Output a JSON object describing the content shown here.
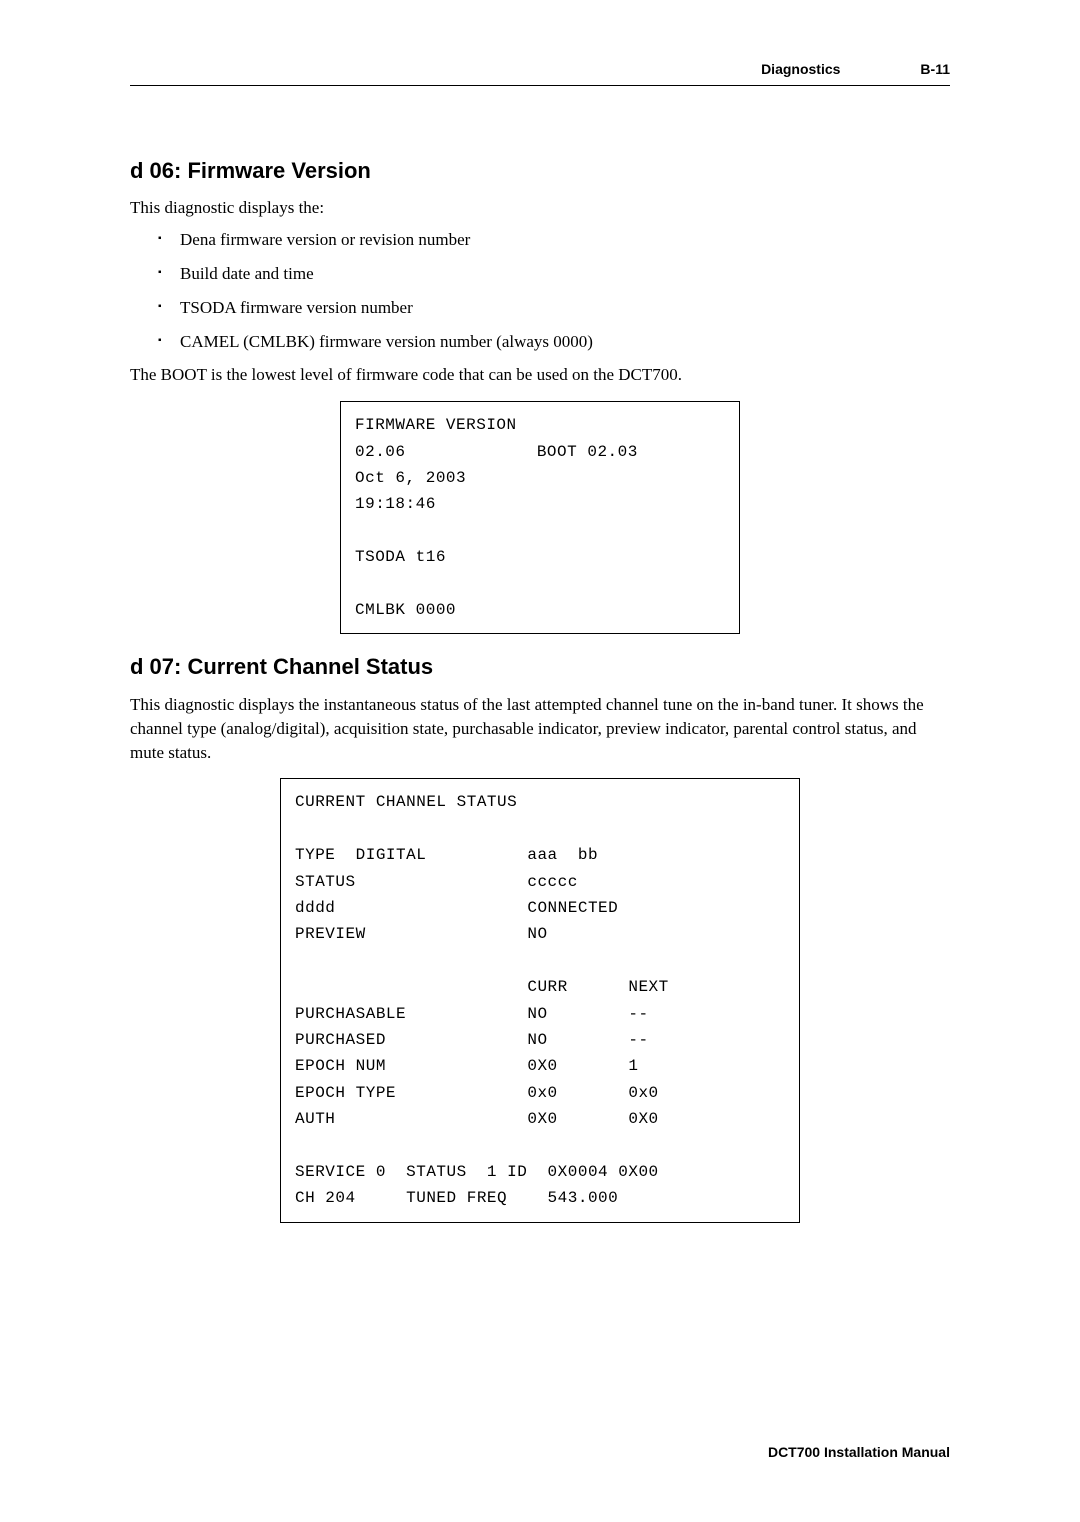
{
  "header": {
    "title": "Diagnostics",
    "page": "B-11"
  },
  "section1": {
    "heading": "d 06: Firmware Version",
    "intro": "This diagnostic displays the:",
    "bullets": [
      "Dena firmware version or revision number",
      "Build date and time",
      "TSODA firmware version number",
      "CAMEL (CMLBK) firmware version number (always 0000)"
    ],
    "outro": "The BOOT is the lowest level of firmware code that can be used on the DCT700.",
    "screen": "FIRMWARE VERSION\n02.06             BOOT 02.03\nOct 6, 2003\n19:18:46\n\nTSODA t16\n\nCMLBK 0000"
  },
  "section2": {
    "heading": "d 07: Current Channel Status",
    "intro": "This diagnostic displays the instantaneous status of the last attempted channel tune on the in-band tuner. It shows the channel type (analog/digital), acquisition state, purchasable indicator, preview indicator, parental control status, and mute status.",
    "screen": "CURRENT CHANNEL STATUS\n\nTYPE  DIGITAL          aaa  bb\nSTATUS                 ccccc\ndddd                   CONNECTED\nPREVIEW                NO\n\n                       CURR      NEXT\nPURCHASABLE            NO        --\nPURCHASED              NO        --\nEPOCH NUM              0X0       1\nEPOCH TYPE             0x0       0x0\nAUTH                   0X0       0X0\n\nSERVICE 0  STATUS  1 ID  0X0004 0X00\nCH 204     TUNED FREQ    543.000"
  },
  "footer": {
    "text": "DCT700 Installation Manual"
  }
}
